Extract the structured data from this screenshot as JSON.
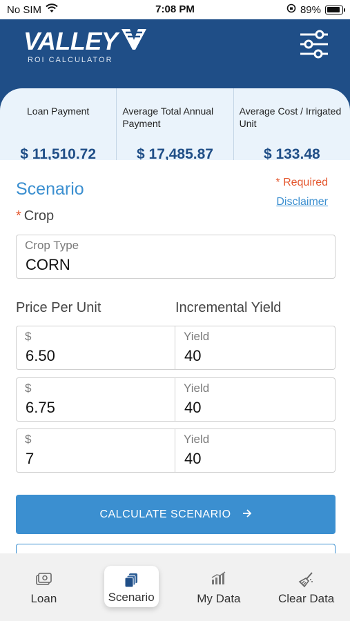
{
  "status": {
    "carrier": "No SIM",
    "time": "7:08 PM",
    "battery": "89%",
    "battery_level": 0.89
  },
  "header": {
    "logo_word": "VALLEY",
    "logo_sub": "ROI CALCULATOR"
  },
  "summary": [
    {
      "label": "Loan Payment",
      "value": "$ 11,510.72"
    },
    {
      "label": "Average Total Annual Payment",
      "value": "$ 17,485.87"
    },
    {
      "label": "Average Cost / Irrigated Unit",
      "value": "$ 133.48"
    }
  ],
  "scenario": {
    "title": "Scenario",
    "required": "* Required",
    "disclaimer": "Disclaimer",
    "crop_label": "Crop",
    "crop_required_mark": "*",
    "crop_type_label": "Crop Type",
    "crop_type_value": "CORN",
    "price_header": "Price Per Unit",
    "yield_header": "Incremental Yield",
    "rows": [
      {
        "price_label": "$",
        "price": "6.50",
        "yield_label": "Yield",
        "yield": "40"
      },
      {
        "price_label": "$",
        "price": "6.75",
        "yield_label": "Yield",
        "yield": "40"
      },
      {
        "price_label": "$",
        "price": "7",
        "yield_label": "Yield",
        "yield": "40"
      }
    ],
    "calculate_label": "CALCULATE SCENARIO"
  },
  "tabs": [
    {
      "label": "Loan",
      "icon": "money-icon"
    },
    {
      "label": "Scenario",
      "icon": "cards-icon",
      "active": true
    },
    {
      "label": "My Data",
      "icon": "bar-chart-icon"
    },
    {
      "label": "Clear Data",
      "icon": "broom-icon"
    }
  ],
  "colors": {
    "brand": "#1f4e87",
    "accent": "#3b8fd0",
    "required": "#e4572e",
    "summary_bg": "#eaf3fb"
  }
}
